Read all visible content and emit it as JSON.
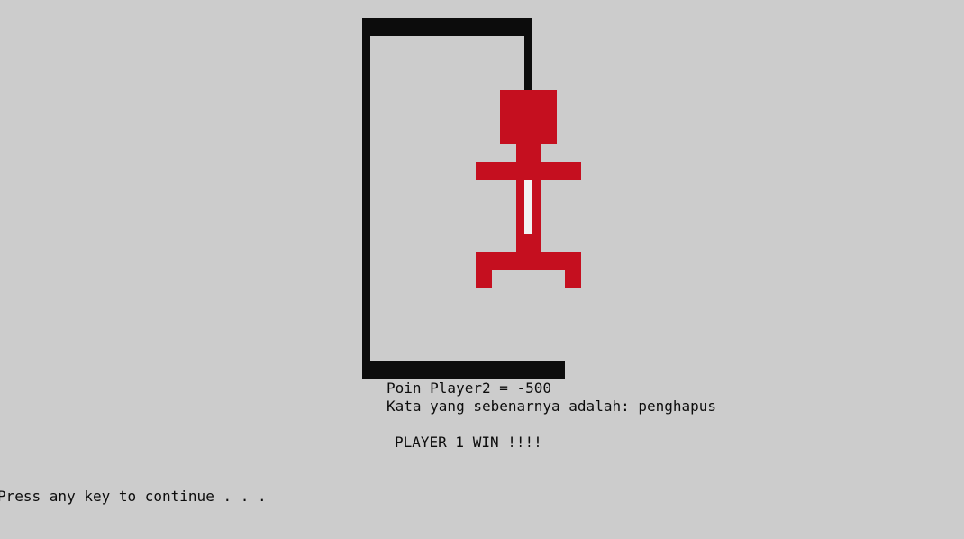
{
  "colors": {
    "background": "#cccccc",
    "gallows": "#0c0c0c",
    "figure": "#c50f1f",
    "figure_highlight": "#f2f2f2",
    "text": "#0c0c0c"
  },
  "console": {
    "score_line": "Poin Player2 = -500",
    "answer_line": "Kata yang sebenarnya adalah: penghapus",
    "result_line": "PLAYER 1 WIN !!!!",
    "continue_prompt": "Press any key to continue . . ."
  }
}
